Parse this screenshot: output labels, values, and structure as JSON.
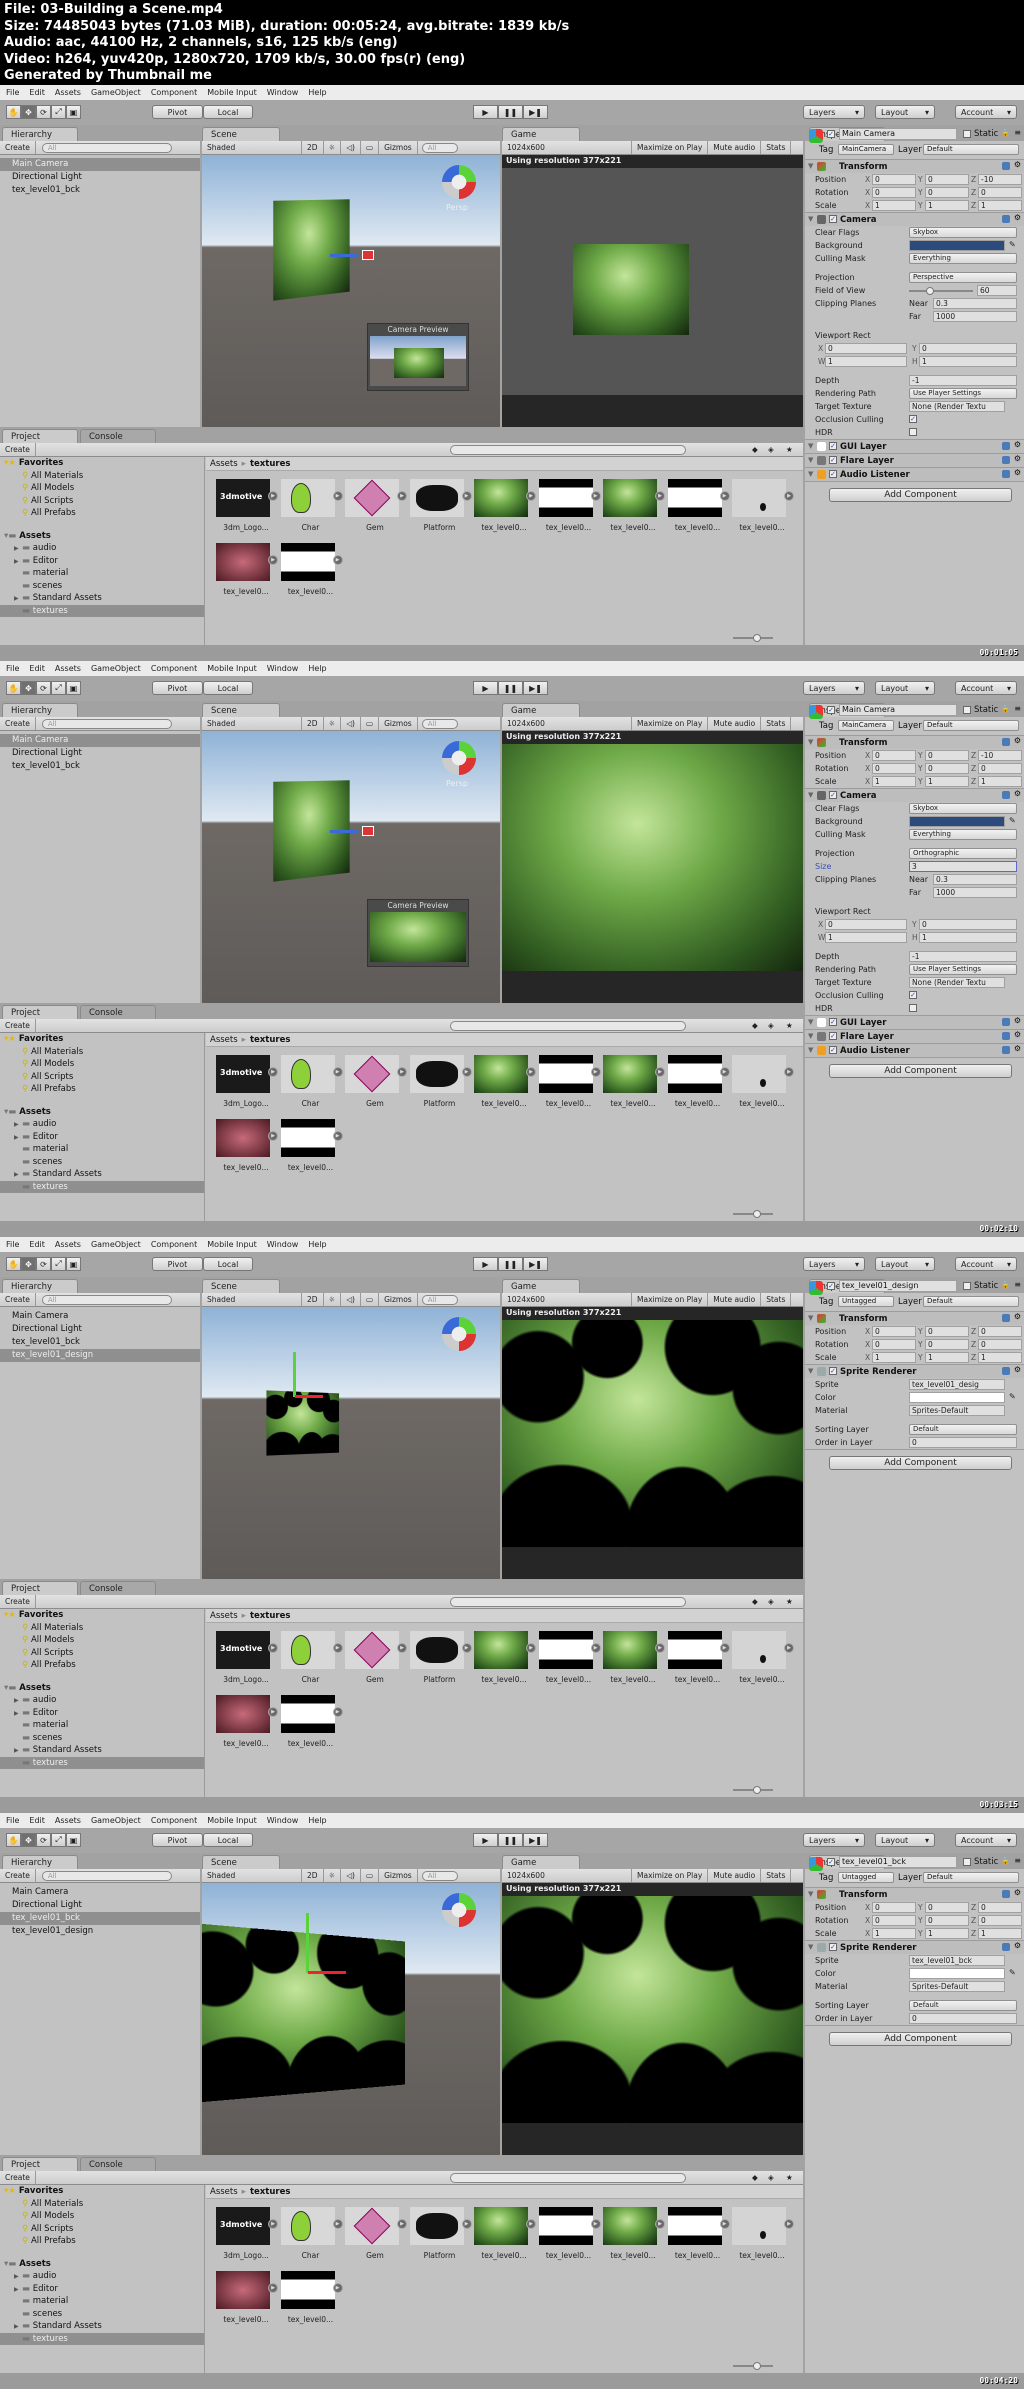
{
  "header": {
    "lines": [
      "File: 03-Building a Scene.mp4",
      "Size: 74485043 bytes (71.03 MiB), duration: 00:05:24, avg.bitrate: 1839 kb/s",
      "Audio: aac, 44100 Hz, 2 channels, s16, 125 kb/s (eng)",
      "Video: h264, yuv420p, 1280x720, 1709 kb/s, 30.00 fps(r) (eng)",
      "Generated by Thumbnail me"
    ]
  },
  "menu": [
    "File",
    "Edit",
    "Assets",
    "GameObject",
    "Component",
    "Mobile Input",
    "Window",
    "Help"
  ],
  "toolbar": {
    "pivot": "Pivot",
    "local": "Local",
    "layers": "Layers",
    "layout": "Layout",
    "account": "Account"
  },
  "labels": {
    "hierarchy": "Hierarchy",
    "scene": "Scene",
    "game": "Game",
    "inspector": "Inspector",
    "project": "Project",
    "console": "Console",
    "create": "Create",
    "search": "All",
    "shaded": "Shaded",
    "two_d": "2D",
    "gizmos": "Gizmos",
    "resolution": "1024x600",
    "maximize": "Maximize on Play",
    "mute": "Mute audio",
    "stats": "Stats",
    "persp": "Persp",
    "camera_preview": "Camera Preview",
    "using_res": "Using resolution 377x221",
    "static": "Static",
    "tag": "Tag",
    "layer": "Layer",
    "add_component": "Add Component"
  },
  "project": {
    "favorites": {
      "label": "Favorites",
      "items": [
        "All Materials",
        "All Models",
        "All Scripts",
        "All Prefabs"
      ]
    },
    "assets": {
      "label": "Assets",
      "items": [
        {
          "label": "audio",
          "expandable": true
        },
        {
          "label": "Editor",
          "expandable": true
        },
        {
          "label": "material",
          "expandable": false
        },
        {
          "label": "scenes",
          "expandable": false
        },
        {
          "label": "Standard Assets",
          "expandable": true
        },
        {
          "label": "textures",
          "expandable": false,
          "selected": true
        }
      ]
    },
    "breadcrumb": [
      "Assets",
      "textures"
    ],
    "grid": [
      {
        "label": "3dm_Logo...",
        "thumb": "logo",
        "logo_text": "3dmotive"
      },
      {
        "label": "Char",
        "thumb": "char"
      },
      {
        "label": "Gem",
        "thumb": "gem"
      },
      {
        "label": "Platform",
        "thumb": "platform"
      },
      {
        "label": "tex_level0...",
        "thumb": "green"
      },
      {
        "label": "tex_level0...",
        "thumb": "bw"
      },
      {
        "label": "tex_level0...",
        "thumb": "green2"
      },
      {
        "label": "tex_level0...",
        "thumb": "bw2"
      },
      {
        "label": "tex_level0...",
        "thumb": "light"
      },
      {
        "label": "tex_level0...",
        "thumb": "red"
      },
      {
        "label": "tex_level0...",
        "thumb": "bw3"
      }
    ]
  },
  "colors": {
    "camera_background": "#2c4a7c",
    "sprite_color": "#ffffff",
    "selection": "#8f8f8f"
  },
  "frames": [
    {
      "timestamp": "00:01:05",
      "hierarchy": [
        "Main Camera",
        "Directional Light",
        "tex_level01_bck"
      ],
      "selected": 0,
      "scene": "camera",
      "game": "small",
      "inspector": {
        "name": "Main Camera",
        "tag": "MainCamera",
        "layer": "Default",
        "components": [
          {
            "title": "Transform",
            "icon": "transform",
            "rows": [
              {
                "k": "xyz",
                "label": "Position",
                "v": [
                  "0",
                  "0",
                  "-10"
                ]
              },
              {
                "k": "xyz",
                "label": "Rotation",
                "v": [
                  "0",
                  "0",
                  "0"
                ]
              },
              {
                "k": "xyz",
                "label": "Scale",
                "v": [
                  "1",
                  "1",
                  "1"
                ]
              }
            ]
          },
          {
            "title": "Camera",
            "icon": "camera",
            "check": true,
            "rows": [
              {
                "k": "drop",
                "label": "Clear Flags",
                "v": "Skybox"
              },
              {
                "k": "color",
                "label": "Background",
                "v": "#2c4a7c"
              },
              {
                "k": "drop",
                "label": "Culling Mask",
                "v": "Everything"
              },
              {
                "k": "gap"
              },
              {
                "k": "drop",
                "label": "Projection",
                "v": "Perspective"
              },
              {
                "k": "slider",
                "label": "Field of View",
                "v": "60",
                "fraction": 0.33
              },
              {
                "k": "pair",
                "label": "Clipping Planes",
                "sub": "Near",
                "v": "0.3"
              },
              {
                "k": "pair",
                "label": "",
                "sub": "Far",
                "v": "1000"
              },
              {
                "k": "gap"
              },
              {
                "k": "title",
                "label": "Viewport Rect"
              },
              {
                "k": "xy",
                "a": "X",
                "av": "0",
                "b": "Y",
                "bv": "0"
              },
              {
                "k": "xy",
                "a": "W",
                "av": "1",
                "b": "H",
                "bv": "1"
              },
              {
                "k": "gap"
              },
              {
                "k": "field",
                "label": "Depth",
                "v": "-1"
              },
              {
                "k": "drop",
                "label": "Rendering Path",
                "v": "Use Player Settings"
              },
              {
                "k": "field",
                "label": "Target Texture",
                "v": "None (Render Textu"
              },
              {
                "k": "check",
                "label": "Occlusion Culling",
                "v": true
              },
              {
                "k": "check",
                "label": "HDR",
                "v": false
              }
            ]
          },
          {
            "title": "GUI Layer",
            "icon": "gui",
            "check": true,
            "rows": []
          },
          {
            "title": "Flare Layer",
            "icon": "flare",
            "check": true,
            "rows": []
          },
          {
            "title": "Audio Listener",
            "icon": "audio",
            "check": true,
            "rows": []
          }
        ]
      }
    },
    {
      "timestamp": "00:02:10",
      "hierarchy": [
        "Main Camera",
        "Directional Light",
        "tex_level01_bck"
      ],
      "selected": 0,
      "scene": "camera",
      "game": "full",
      "inspector": {
        "name": "Main Camera",
        "tag": "MainCamera",
        "layer": "Default",
        "components": [
          {
            "title": "Transform",
            "icon": "transform",
            "rows": [
              {
                "k": "xyz",
                "label": "Position",
                "v": [
                  "0",
                  "0",
                  "-10"
                ]
              },
              {
                "k": "xyz",
                "label": "Rotation",
                "v": [
                  "0",
                  "0",
                  "0"
                ]
              },
              {
                "k": "xyz",
                "label": "Scale",
                "v": [
                  "1",
                  "1",
                  "1"
                ]
              }
            ]
          },
          {
            "title": "Camera",
            "icon": "camera",
            "check": true,
            "rows": [
              {
                "k": "drop",
                "label": "Clear Flags",
                "v": "Skybox"
              },
              {
                "k": "color",
                "label": "Background",
                "v": "#2c4a7c"
              },
              {
                "k": "drop",
                "label": "Culling Mask",
                "v": "Everything"
              },
              {
                "k": "gap"
              },
              {
                "k": "drop",
                "label": "Projection",
                "v": "Orthographic"
              },
              {
                "k": "field",
                "label": "Size",
                "v": "3",
                "focus": true
              },
              {
                "k": "pair",
                "label": "Clipping Planes",
                "sub": "Near",
                "v": "0.3"
              },
              {
                "k": "pair",
                "label": "",
                "sub": "Far",
                "v": "1000"
              },
              {
                "k": "gap"
              },
              {
                "k": "title",
                "label": "Viewport Rect"
              },
              {
                "k": "xy",
                "a": "X",
                "av": "0",
                "b": "Y",
                "bv": "0"
              },
              {
                "k": "xy",
                "a": "W",
                "av": "1",
                "b": "H",
                "bv": "1"
              },
              {
                "k": "gap"
              },
              {
                "k": "field",
                "label": "Depth",
                "v": "-1"
              },
              {
                "k": "drop",
                "label": "Rendering Path",
                "v": "Use Player Settings"
              },
              {
                "k": "field",
                "label": "Target Texture",
                "v": "None (Render Textu"
              },
              {
                "k": "check",
                "label": "Occlusion Culling",
                "v": true
              },
              {
                "k": "check",
                "label": "HDR",
                "v": false
              }
            ]
          },
          {
            "title": "GUI Layer",
            "icon": "gui",
            "check": true,
            "rows": []
          },
          {
            "title": "Flare Layer",
            "icon": "flare",
            "check": true,
            "rows": []
          },
          {
            "title": "Audio Listener",
            "icon": "audio",
            "check": true,
            "rows": []
          }
        ]
      }
    },
    {
      "timestamp": "00:03:15",
      "hierarchy": [
        "Main Camera",
        "Directional Light",
        "tex_level01_bck",
        "tex_level01_design"
      ],
      "selected": 3,
      "scene": "sprite_small",
      "game": "design",
      "inspector": {
        "name": "tex_level01_design",
        "tag": "Untagged",
        "layer": "Default",
        "components": [
          {
            "title": "Transform",
            "icon": "transform",
            "rows": [
              {
                "k": "xyz",
                "label": "Position",
                "v": [
                  "0",
                  "0",
                  "0"
                ]
              },
              {
                "k": "xyz",
                "label": "Rotation",
                "v": [
                  "0",
                  "0",
                  "0"
                ]
              },
              {
                "k": "xyz",
                "label": "Scale",
                "v": [
                  "1",
                  "1",
                  "1"
                ]
              }
            ]
          },
          {
            "title": "Sprite Renderer",
            "icon": "sprite",
            "check": true,
            "rows": [
              {
                "k": "field",
                "label": "Sprite",
                "v": "tex_level01_desig"
              },
              {
                "k": "color",
                "label": "Color",
                "v": "#ffffff"
              },
              {
                "k": "field",
                "label": "Material",
                "v": "Sprites-Default"
              },
              {
                "k": "gap"
              },
              {
                "k": "drop",
                "label": "Sorting Layer",
                "v": "Default"
              },
              {
                "k": "field",
                "label": "Order in Layer",
                "v": "0"
              }
            ]
          }
        ]
      }
    },
    {
      "timestamp": "00:04:20",
      "hierarchy": [
        "Main Camera",
        "Directional Light",
        "tex_level01_bck",
        "tex_level01_design"
      ],
      "selected": 2,
      "scene": "sprite_large",
      "game": "design",
      "inspector": {
        "name": "tex_level01_bck",
        "tag": "Untagged",
        "layer": "Default",
        "components": [
          {
            "title": "Transform",
            "icon": "transform",
            "rows": [
              {
                "k": "xyz",
                "label": "Position",
                "v": [
                  "0",
                  "0",
                  "0"
                ]
              },
              {
                "k": "xyz",
                "label": "Rotation",
                "v": [
                  "0",
                  "0",
                  "0"
                ]
              },
              {
                "k": "xyz",
                "label": "Scale",
                "v": [
                  "1",
                  "1",
                  "1"
                ]
              }
            ]
          },
          {
            "title": "Sprite Renderer",
            "icon": "sprite",
            "check": true,
            "rows": [
              {
                "k": "field",
                "label": "Sprite",
                "v": "tex_level01_bck"
              },
              {
                "k": "color",
                "label": "Color",
                "v": "#ffffff"
              },
              {
                "k": "field",
                "label": "Material",
                "v": "Sprites-Default"
              },
              {
                "k": "gap"
              },
              {
                "k": "drop",
                "label": "Sorting Layer",
                "v": "Default"
              },
              {
                "k": "field",
                "label": "Order in Layer",
                "v": "0"
              }
            ]
          }
        ]
      }
    }
  ]
}
